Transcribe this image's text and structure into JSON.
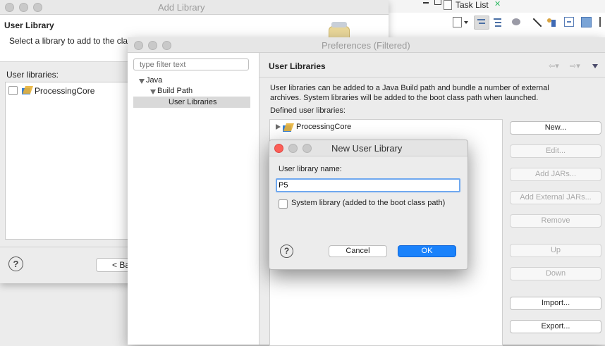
{
  "eclipse_right": {
    "task_list_tab": "Task List",
    "task_list_close": "✕"
  },
  "add_library": {
    "title": "Add Library",
    "heading": "User Library",
    "instructions": "Select a library to add to the cla",
    "user_libraries_label": "User libraries:",
    "libraries": [
      {
        "name": "ProcessingCore",
        "checked": false
      }
    ],
    "back_button": "< Ba",
    "help": "?"
  },
  "preferences": {
    "title": "Preferences (Filtered)",
    "filter_placeholder": "type filter text",
    "tree": {
      "java": "Java",
      "build_path": "Build Path",
      "user_libraries": "User Libraries"
    },
    "page_title": "User Libraries",
    "description": "User libraries can be added to a Java Build path and bundle a number of external archives. System libraries will be added to the boot class path when launched.",
    "defined_label": "Defined user libraries:",
    "defined_libraries": [
      {
        "name": "ProcessingCore"
      }
    ],
    "buttons": {
      "new": "New...",
      "edit": "Edit...",
      "add_jars": "Add JARs...",
      "add_external_jars": "Add External JARs...",
      "remove": "Remove",
      "up": "Up",
      "down": "Down",
      "import": "Import...",
      "export": "Export..."
    }
  },
  "new_user_library": {
    "title": "New User Library",
    "name_label": "User library name:",
    "name_value": "P5",
    "system_library_label": "System library (added to the boot class path)",
    "system_library_checked": false,
    "cancel": "Cancel",
    "ok": "OK",
    "help": "?"
  },
  "colors": {
    "ok_blue": "#1a82fb",
    "focus_blue": "#6fa8ef",
    "selection_gray": "#d9d9d9",
    "close_red": "#fc5f57"
  }
}
